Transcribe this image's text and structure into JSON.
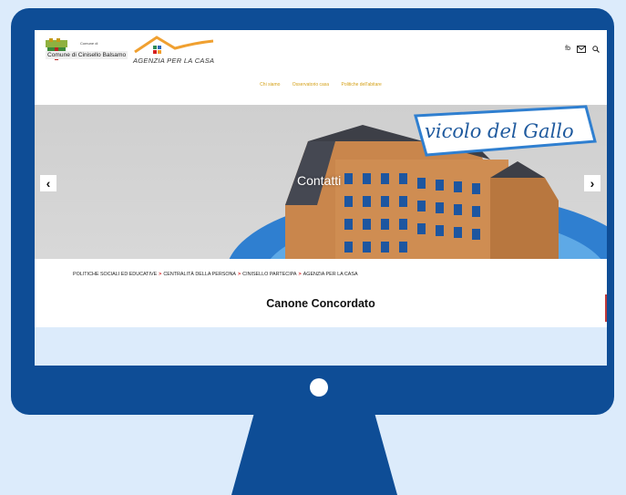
{
  "header": {
    "comune_small": "Comune di",
    "comune_name": "Comune di Cinisello Balsamo",
    "agenzia_name": "AGENZIA PER LA CASA",
    "icons": {
      "facebook": "fb",
      "mail": "mail-icon",
      "search": "search-icon"
    }
  },
  "nav": {
    "items": [
      "Chi siamo",
      "Osservatorio casa",
      "Politiche dell'abitare"
    ]
  },
  "hero": {
    "caption": "Contatti",
    "banner": "vicolo del Gallo",
    "prev": "‹",
    "next": "›"
  },
  "breadcrumb": {
    "items": [
      "POLITICHE SOCIALI ED EDUCATIVE",
      "CENTRALITÀ DELLA PERSONA",
      "CINISELLO PARTECIPA",
      "AGENZIA PER LA CASA"
    ],
    "separator": ">"
  },
  "page": {
    "heading": "Canone Concordato"
  },
  "colors": {
    "bezel": "#0e4d96",
    "background": "#dcebfb",
    "nav_link": "#d4a017",
    "accent_red": "#d62020",
    "banner_blue": "#1f5a9e"
  }
}
